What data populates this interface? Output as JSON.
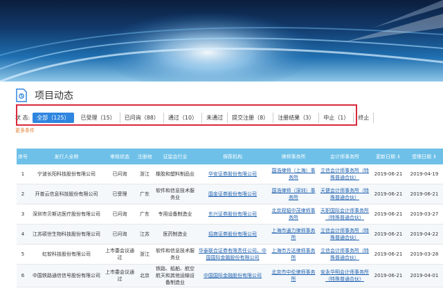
{
  "page": {
    "title": "项目动态"
  },
  "filters": {
    "label": "状 态:",
    "items": [
      {
        "label": "全部（125）",
        "active": true
      },
      {
        "label": "已受理（15）"
      },
      {
        "label": "已问询（88）"
      },
      {
        "label": "通过（10）"
      },
      {
        "label": "未通过"
      },
      {
        "label": "提交注册（8）"
      },
      {
        "label": "注册结果（3）"
      },
      {
        "label": "中止（1）"
      },
      {
        "label": "终止"
      }
    ],
    "expand_link": "更多条件"
  },
  "table": {
    "headers": [
      "序号",
      "发行人全称",
      "审核状态",
      "注册地",
      "证监会行业",
      "保荐机构",
      "律师事务所",
      "会计师事务所",
      "更新日期",
      "受理日期"
    ],
    "rows": [
      {
        "no": "1",
        "issuer": "宁波长阳科技股份有限公司",
        "status": "已问询",
        "region": "浙江",
        "industry": "橡胶和塑料制品业",
        "sponsor": "华安证券股份有限公司",
        "law": "国浩律师（上海）事务所",
        "accounting": "立信会计师事务所（特殊普通合伙）",
        "updated": "2019-06-21",
        "accepted": "2019-04-19"
      },
      {
        "no": "2",
        "issuer": "开普云信息科技股份有限公司",
        "status": "已受理",
        "region": "广东",
        "industry": "软件和信息技术服务业",
        "sponsor": "国金证券股份有限公司",
        "law": "国浩律师（深圳）事务所",
        "accounting": "天健会计师事务所（特殊普通合伙）",
        "updated": "2019-06-21",
        "accepted": "2019-06-21"
      },
      {
        "no": "3",
        "issuer": "深圳市贝斯达医疗股份有限公司",
        "status": "已问询",
        "region": "广东",
        "industry": "专用设备制造业",
        "sponsor": "东兴证券股份有限公司",
        "law": "北京观韬中茂律师事务所",
        "accounting": "天职国际会计师事务所（特殊普通合伙）",
        "updated": "2019-06-21",
        "accepted": "2019-03-27"
      },
      {
        "no": "4",
        "issuer": "江苏硕世生物科技股份有限公司",
        "status": "已问询",
        "region": "江苏",
        "industry": "医药制造业",
        "sponsor": "招商证券股份有限公司",
        "law": "上海市通力律师事务所",
        "accounting": "立信会计师事务所（特殊普通合伙）",
        "updated": "2019-06-21",
        "accepted": "2019-04-22"
      },
      {
        "no": "5",
        "issuer": "虹软科技股份有限公司",
        "status": "上市委会议通过",
        "region": "浙江",
        "industry": "软件和信息技术服务业",
        "sponsor": "华泰联合证券有限责任公司、中国国际金融股份有限公司",
        "law": "上海市方达律师事务所",
        "accounting": "立信会计师事务所（特殊普通合伙）",
        "updated": "2019-06-21",
        "accepted": "2019-03-28"
      },
      {
        "no": "6",
        "issuer": "中国铁路通信信号股份有限公司",
        "status": "上市委会议通过",
        "region": "北京",
        "industry": "铁路、船舶、航空航天和其他运输设备制造业",
        "sponsor": "中国国际金融股份有限公司",
        "law": "北京市中伦律师事务所",
        "accounting": "安永华明会计师事务所（特殊普通合伙）",
        "updated": "2019-06-21",
        "accepted": "2019-04-01"
      }
    ]
  }
}
